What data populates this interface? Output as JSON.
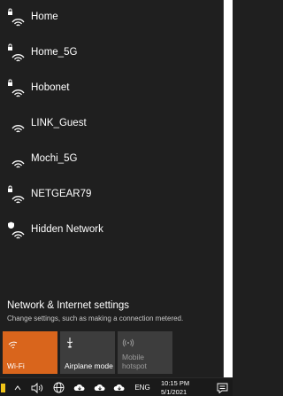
{
  "networks": [
    {
      "name": "Home",
      "secured": true
    },
    {
      "name": "Home_5G",
      "secured": true
    },
    {
      "name": "Hobonet",
      "secured": true
    },
    {
      "name": "LINK_Guest",
      "secured": false
    },
    {
      "name": "Mochi_5G",
      "secured": false
    },
    {
      "name": "NETGEAR79",
      "secured": true
    },
    {
      "name": "Hidden Network",
      "secured": true
    }
  ],
  "settings": {
    "title": "Network & Internet settings",
    "subtitle": "Change settings, such as making a connection metered."
  },
  "quick_actions": [
    {
      "label": "Wi-Fi",
      "icon": "wifi-icon",
      "active": true
    },
    {
      "label": "Airplane mode",
      "icon": "airplane-icon",
      "active": false
    },
    {
      "label": "Mobile\nhotspot",
      "icon": "hotspot-icon",
      "active": false
    }
  ],
  "taskbar": {
    "language": "ENG",
    "time": "10:15 PM",
    "date": "5/1/2021"
  },
  "colors": {
    "accent": "#d9651c",
    "flyout_bg": "#1f1f1f",
    "tile_bg": "#3d3d3d"
  }
}
